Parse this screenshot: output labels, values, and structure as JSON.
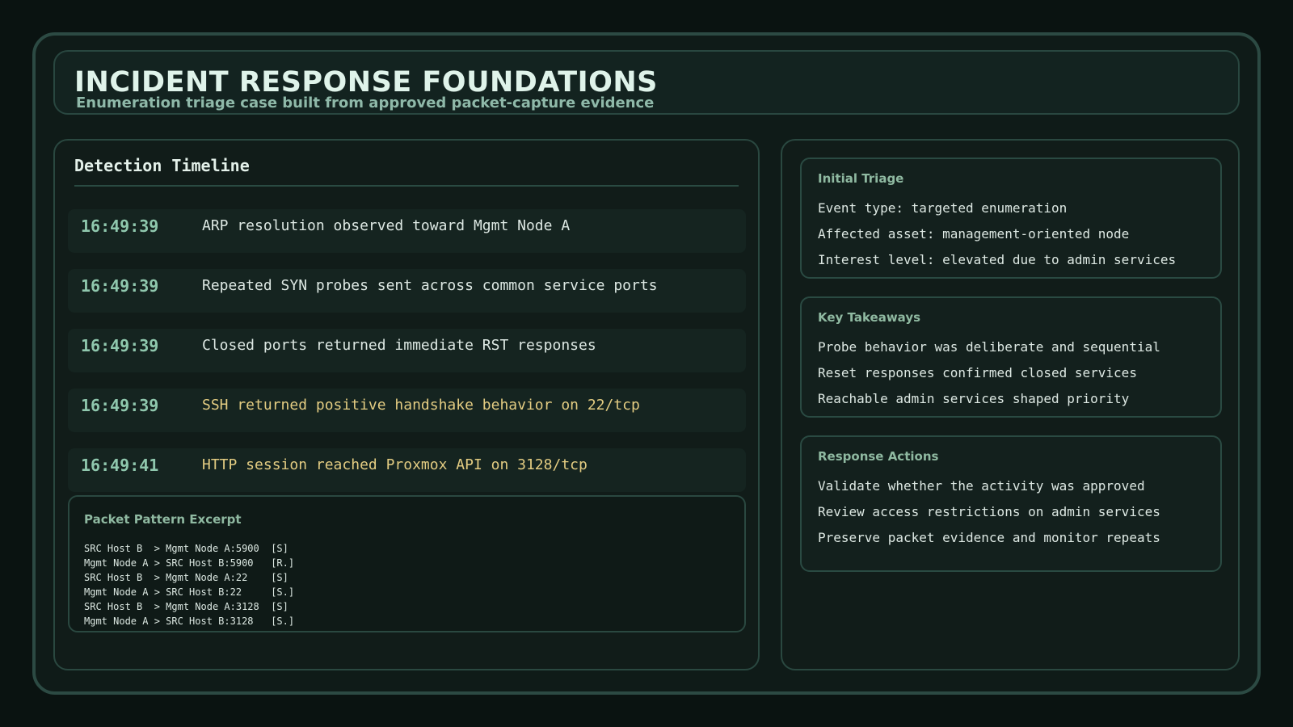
{
  "header": {
    "title": "INCIDENT RESPONSE FOUNDATIONS",
    "subtitle": "Enumeration triage case built from approved packet-capture evidence"
  },
  "timeline": {
    "title": "Detection Timeline",
    "events": [
      {
        "time": "16:49:39",
        "text": "ARP resolution observed toward Mgmt Node A"
      },
      {
        "time": "16:49:39",
        "text": "Repeated SYN probes sent across common service ports"
      },
      {
        "time": "16:49:39",
        "text": "Closed ports returned immediate RST responses"
      },
      {
        "time": "16:49:39",
        "text": "SSH returned positive handshake behavior on 22/tcp"
      },
      {
        "time": "16:49:41",
        "text": "HTTP session reached Proxmox API on 3128/tcp"
      }
    ]
  },
  "packet_excerpt": {
    "title": "Packet Pattern Excerpt",
    "lines": [
      "SRC Host B  > Mgmt Node A:5900  [S]",
      "Mgmt Node A > SRC Host B:5900   [R.]",
      "SRC Host B  > Mgmt Node A:22    [S]",
      "Mgmt Node A > SRC Host B:22     [S.]",
      "SRC Host B  > Mgmt Node A:3128  [S]",
      "Mgmt Node A > SRC Host B:3128   [S.]"
    ]
  },
  "cards": {
    "initial_triage": {
      "title": "Initial Triage",
      "items": [
        "Event type: targeted enumeration",
        "Affected asset: management-oriented node",
        "Interest level: elevated due to admin services"
      ]
    },
    "key_takeaways": {
      "title": "Key Takeaways",
      "items": [
        "Probe behavior was deliberate and sequential",
        "Reset responses confirmed closed services",
        "Reachable admin services shaped priority"
      ]
    },
    "response_actions": {
      "title": "Response Actions",
      "items": [
        "Validate whether the activity was approved",
        "Review access restrictions on admin services",
        "Preserve packet evidence and monitor repeats"
      ]
    }
  },
  "colors": {
    "background": "#0a1311",
    "accent": "#8fc7ad",
    "highlight": "#e3cc82",
    "border": "#2a4840"
  }
}
